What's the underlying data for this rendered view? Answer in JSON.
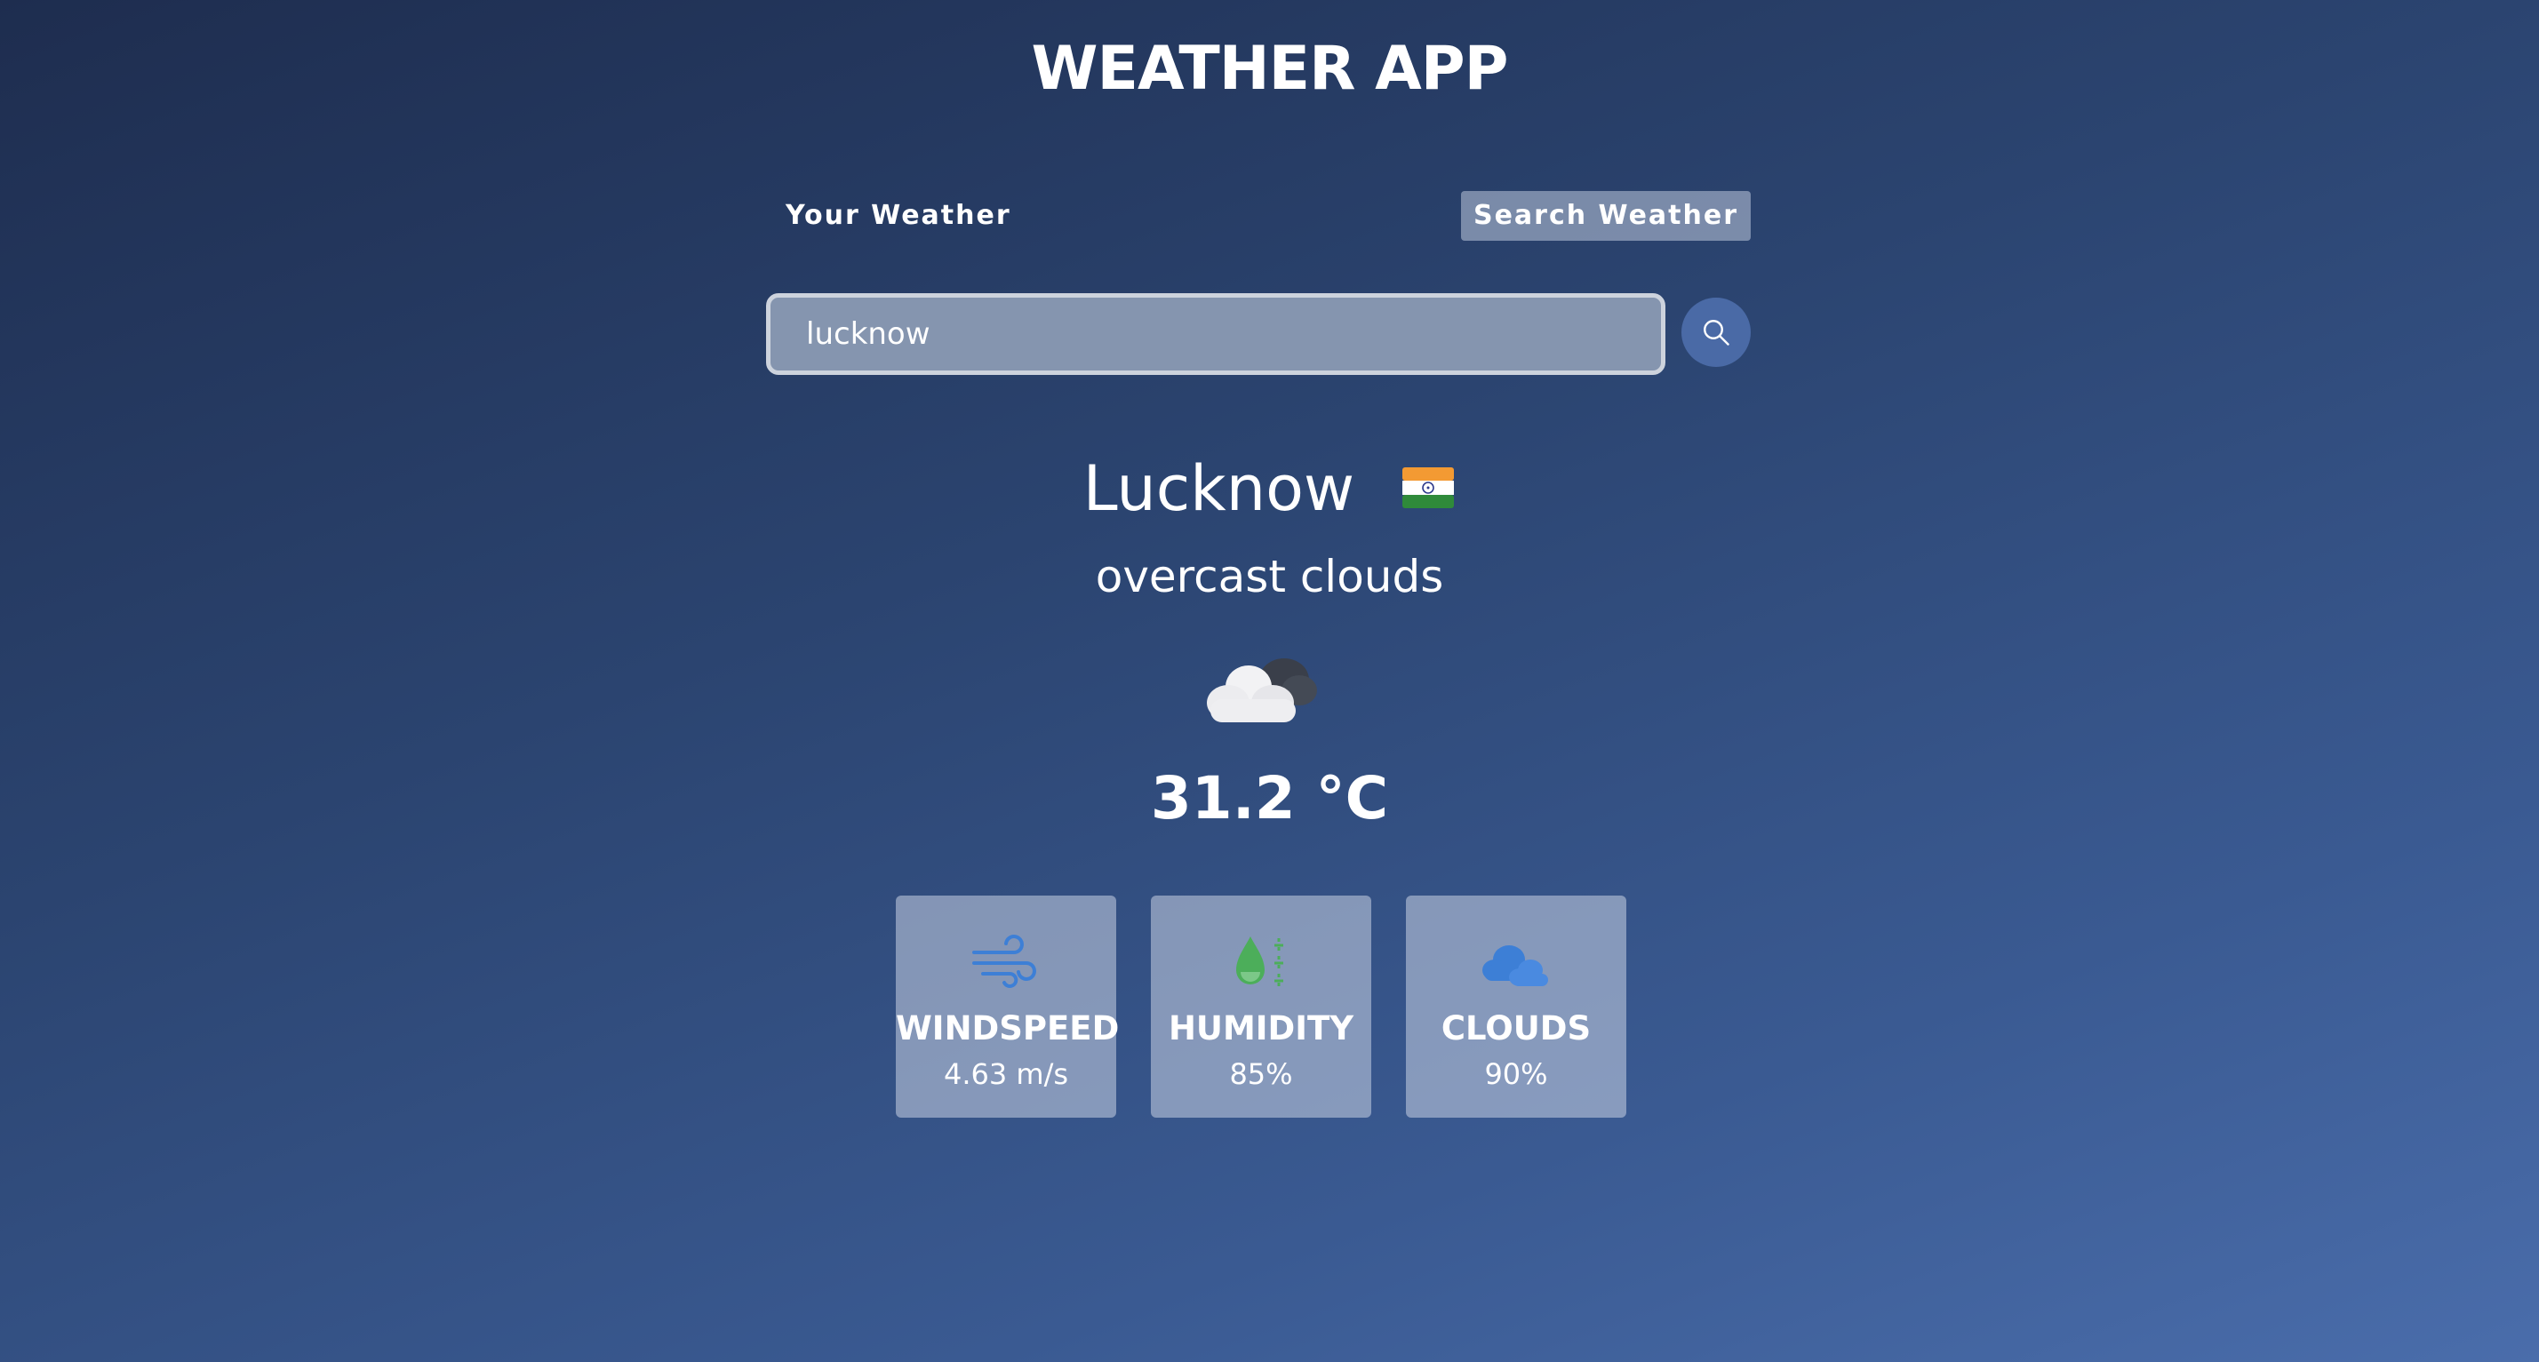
{
  "header": {
    "title": "WEATHER APP"
  },
  "tabs": [
    {
      "label": "Your Weather"
    },
    {
      "label": "Search Weather"
    }
  ],
  "search": {
    "value": "lucknow",
    "icon": "search-icon"
  },
  "weather": {
    "city": "Lucknow",
    "country_flag": "india-flag-icon",
    "description": "overcast clouds",
    "condition_icon": "overcast-clouds-icon",
    "temperature": "31.2 °C"
  },
  "stats": [
    {
      "title": "WINDSPEED",
      "value": "4.63 m/s",
      "icon": "wind-icon",
      "icon_color": "#3d7fd6"
    },
    {
      "title": "HUMIDITY",
      "value": "85%",
      "icon": "humidity-icon",
      "icon_color": "#4cae5a"
    },
    {
      "title": "CLOUDS",
      "value": "90%",
      "icon": "clouds-icon",
      "icon_color": "#3d7fd6"
    }
  ],
  "colors": {
    "background_top": "#1e2d4f",
    "background_bottom": "#4a6dab",
    "search_button": "#4a6aa6"
  }
}
